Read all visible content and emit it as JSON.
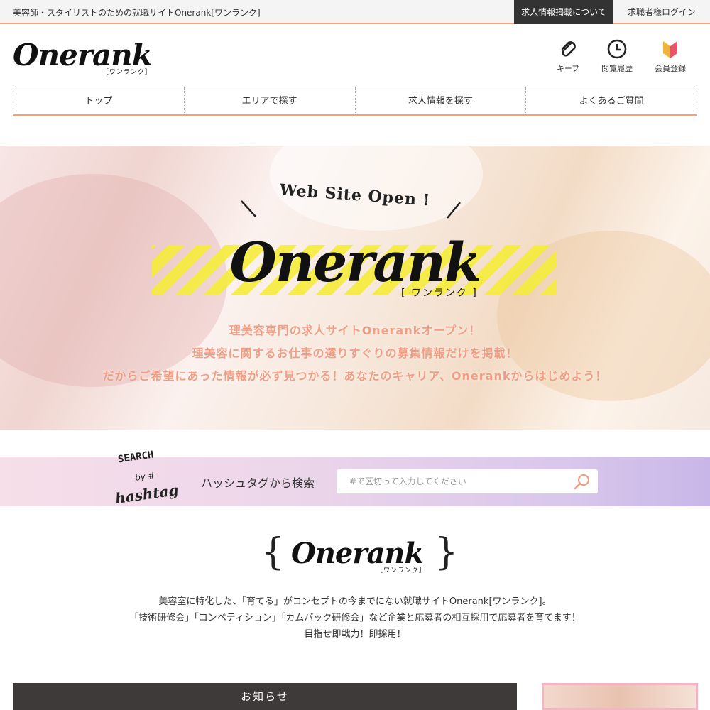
{
  "topbar": {
    "tagline": "美容師・スタイリストのための就職サイトOnerank[ワンランク]",
    "employer_link": "求人情報掲載について",
    "login_link": "求職者様ログイン"
  },
  "header": {
    "logo_text": "Onerank",
    "logo_sub": "［ワンランク］",
    "icons": [
      {
        "name": "paperclip-icon",
        "label": "キープ"
      },
      {
        "name": "clock-icon",
        "label": "閲覧履歴"
      },
      {
        "name": "beginner-mark-icon",
        "label": "会員登録"
      }
    ]
  },
  "nav": {
    "items": [
      "トップ",
      "エリアで探す",
      "求人情報を探す",
      "よくあるご質問"
    ]
  },
  "hero": {
    "tag": "Web Site Open !",
    "logo_text": "Onerank",
    "logo_sub": "[ ワンランク ]",
    "lines": [
      "理美容専門の求人サイトOnerankオープン！",
      "理美容に関するお仕事の選りすぐりの募集情報だけを掲載！",
      "だからご希望にあった情報が必ず見つかる！あなたのキャリア、Onerankからはじめよう！"
    ]
  },
  "search": {
    "badge_line1": "SEARCH",
    "badge_line2": "by #",
    "badge_line3": "hashtag",
    "label": "ハッシュタグから検索",
    "placeholder": "#で区切って入力してください"
  },
  "about": {
    "logo_text": "Onerank",
    "logo_sub": "［ワンランク］",
    "lines": [
      "美容室に特化した、「育てる」がコンセプトの今までにない就職サイトOnerank[ワンランク]。",
      "「技術研修会」「コンペティション」「カムバック研修会」など企業と応募者の相互採用で応募者を育てます！",
      "目指せ即戦力！即採用！"
    ]
  },
  "notice": {
    "title": "お知らせ"
  },
  "colors": {
    "accent": "#f0a27a",
    "hero_text": "#f19d84",
    "stripe": "#f5ec3a",
    "dark": "#3e3a39"
  }
}
